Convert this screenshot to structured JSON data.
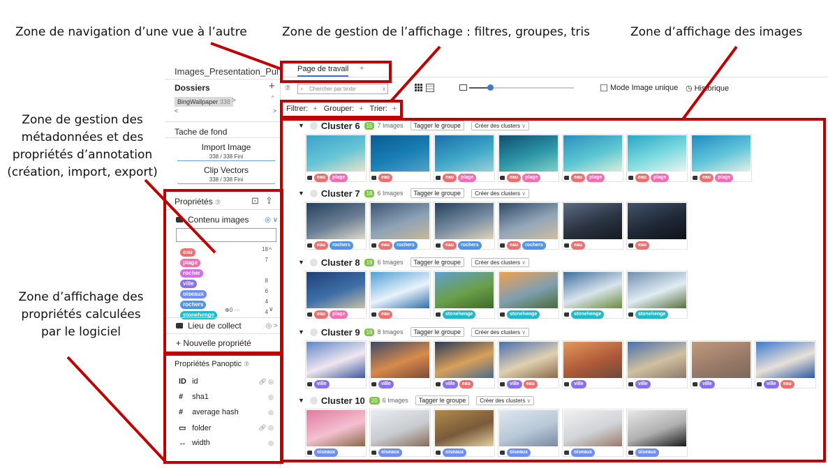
{
  "annotations": {
    "nav": "Zone de navigation d’une vue à l’autre",
    "display_mgmt": "Zone de gestion de l’affichage : filtres, groupes, tris",
    "images_zone": "Zone d’affichage des images",
    "meta_lines": [
      "Zone de gestion des",
      "métadonnées et des",
      "propriétés d’annotation",
      "(création, import, export)"
    ],
    "computed_lines": [
      "Zone d’affichage des",
      "propriétés calculées",
      "par le logiciel"
    ]
  },
  "app": {
    "project_title": "Images_Presentation_Publiq",
    "tab_label": "Page de travail",
    "tab_plus": "+",
    "search_placeholder": "Chercher par texte",
    "search_clear": "x",
    "help_glyph": "⑦",
    "mode_image_unique": "Mode Image unique",
    "historique": "Historique",
    "zoom_level": 0.2,
    "filters": {
      "filter": "Filtrer:",
      "group": "Grouper:",
      "sort": "Trier:",
      "plus": "+"
    }
  },
  "sidebar": {
    "dossiers_title": "Dossiers",
    "dossiers_plus": "+",
    "folder_name": "BingWallpaper",
    "folder_count": "338",
    "folder_chevron": ">",
    "tache_title": "Tache de fond",
    "tasks": [
      {
        "name": "Import Image",
        "status": "338 / 338 Fini"
      },
      {
        "name": "Clip Vectors",
        "status": "338 / 338 Fini"
      }
    ],
    "proprietes_title": "Propriétés",
    "contenu_label": "Contenu images",
    "tag_counts": [
      {
        "name": "eau",
        "count": "18",
        "color": "#ef6f6f"
      },
      {
        "name": "plage",
        "count": "7",
        "color": "#f06db0"
      },
      {
        "name": "rocher",
        "count": "",
        "color": "#d46be8"
      },
      {
        "name": "ville",
        "count": "8",
        "color": "#8a6ff0"
      },
      {
        "name": "oiseaux",
        "count": "6",
        "color": "#6d8ef2"
      },
      {
        "name": "rochers",
        "count": "4",
        "color": "#4f94e8"
      },
      {
        "name": "stonehenge",
        "count": "4",
        "color": "#21b8c9"
      }
    ],
    "stone_extra": "⊕0 ···",
    "lieu_label": "Lieu de collect",
    "nouvelle_label": "+ Nouvelle propriété",
    "panoptic_title": "Propriétés Panoptic",
    "panoptic_props": [
      {
        "icon": "ID",
        "name": "id"
      },
      {
        "icon": "#",
        "name": "sha1"
      },
      {
        "icon": "#",
        "name": "average hash"
      },
      {
        "icon": "▭",
        "name": "folder"
      },
      {
        "icon": "↔",
        "name": "width"
      }
    ]
  },
  "clusters": [
    {
      "title": "Cluster 6",
      "badge": "15",
      "count": "7 Images",
      "tag_btn": "Tagger le groupe",
      "create_btn": "Créer des clusters",
      "images": [
        [
          "eau",
          "plage"
        ],
        [
          "eau"
        ],
        [
          "eau",
          "plage"
        ],
        [
          "eau",
          "plage"
        ],
        [
          "eau",
          "plage"
        ],
        [
          "eau",
          "plage"
        ],
        [
          "eau",
          "plage"
        ]
      ],
      "palettes": [
        [
          "#3aa3c9",
          "#68c5d6",
          "#e8e4c8"
        ],
        [
          "#0a5c8f",
          "#1a7fb5",
          "#53a3c7"
        ],
        [
          "#1b6fa8",
          "#3fa7c8",
          "#9cd2d8"
        ],
        [
          "#0f4e6e",
          "#2d96a8",
          "#7fd1c7"
        ],
        [
          "#2a8fbf",
          "#5cc7d2",
          "#d9edd9"
        ],
        [
          "#27a7c4",
          "#7fdbe0",
          "#eef4f0"
        ],
        [
          "#1f8cc2",
          "#63c6da",
          "#e4efe6"
        ]
      ]
    },
    {
      "title": "Cluster 7",
      "badge": "18",
      "count": "6 Images",
      "tag_btn": "Tagger le groupe",
      "create_btn": "Créer des clusters",
      "images": [
        [
          "eau",
          "rochers"
        ],
        [
          "eau",
          "rochers"
        ],
        [
          "eau",
          "rochers"
        ],
        [
          "eau",
          "rochers"
        ],
        [
          "eau"
        ],
        [
          "eau"
        ]
      ],
      "palettes": [
        [
          "#23425e",
          "#6b7f94",
          "#e0d8c8"
        ],
        [
          "#3b5673",
          "#8ea2b6",
          "#c8b79a"
        ],
        [
          "#24405e",
          "#7a8ea3",
          "#e1d3b7"
        ],
        [
          "#2e4a66",
          "#93a6b9",
          "#cfbea0"
        ],
        [
          "#5b6d82",
          "#2a3341",
          "#151a21"
        ],
        [
          "#42536a",
          "#1f2835",
          "#0f131a"
        ]
      ]
    },
    {
      "title": "Cluster 8",
      "badge": "19",
      "count": "6 Images",
      "tag_btn": "Tagger le groupe",
      "create_btn": "Créer des clusters",
      "images": [
        [
          "eau",
          "plage"
        ],
        [
          "eau"
        ],
        [
          "stonehenge"
        ],
        [
          "stonehenge"
        ],
        [
          "stonehenge"
        ],
        [
          "stonehenge"
        ]
      ],
      "palettes": [
        [
          "#1f3f77",
          "#3f6fa8",
          "#c8c0a8"
        ],
        [
          "#4f9fd6",
          "#e8f2fa",
          "#2f6fa8"
        ],
        [
          "#5f9fd0",
          "#6b9f4a",
          "#3d6b2a"
        ],
        [
          "#f0a050",
          "#7f9fb0",
          "#4a6b3a"
        ],
        [
          "#3f6f9f",
          "#d8e4ec",
          "#6b8b3a"
        ],
        [
          "#6f8fb0",
          "#e0ecf2",
          "#5a6f3a"
        ]
      ]
    },
    {
      "title": "Cluster 9",
      "badge": "19",
      "count": "8 Images",
      "tag_btn": "Tagger le groupe",
      "create_btn": "Créer des clusters",
      "images": [
        [
          "ville"
        ],
        [
          "ville"
        ],
        [
          "ville",
          "eau"
        ],
        [
          "ville",
          "eau"
        ],
        [
          "ville"
        ],
        [
          "ville"
        ],
        [
          "ville"
        ],
        [
          "ville",
          "eau"
        ]
      ],
      "palettes": [
        [
          "#5f86c8",
          "#f0e6f0",
          "#3a5a9a"
        ],
        [
          "#3a4a6a",
          "#d88a4a",
          "#7a4a3a"
        ],
        [
          "#2a3a5a",
          "#d8a05a",
          "#4a6a8a"
        ],
        [
          "#4a6fb0",
          "#e0d0b0",
          "#8a6a4a"
        ],
        [
          "#e09a5a",
          "#b05a3a",
          "#6a4a3a"
        ],
        [
          "#4a6fb0",
          "#d0c0a0",
          "#8a7a6a"
        ],
        [
          "#c09a7a",
          "#9a7a6a",
          "#7a6a5a"
        ],
        [
          "#3a7ad0",
          "#e8e0d8",
          "#2a5aa0"
        ]
      ]
    },
    {
      "title": "Cluster 10",
      "badge": "20",
      "count": "6 Images",
      "tag_btn": "Tagger le groupe",
      "create_btn": "Créer des clusters",
      "images": [
        [
          "oiseaux"
        ],
        [
          "oiseaux"
        ],
        [
          "oiseaux"
        ],
        [
          "oiseaux"
        ],
        [
          "oiseaux"
        ],
        [
          "oiseaux"
        ]
      ],
      "palettes": [
        [
          "#e07aa0",
          "#f4c0d0",
          "#8a6a4a"
        ],
        [
          "#e8ecf0",
          "#c8ccd0",
          "#8a6a5a"
        ],
        [
          "#b08a4a",
          "#7a5a3a",
          "#e0d0a0"
        ],
        [
          "#dfe6ee",
          "#b8c8d8",
          "#7a8aa0"
        ],
        [
          "#f0f0f0",
          "#d0d4d8",
          "#9a7a6a"
        ],
        [
          "#e8e8e8",
          "#b0b0b0",
          "#1a1a1a"
        ]
      ]
    }
  ],
  "tag_colors": {
    "eau": "#ef6f6f",
    "plage": "#f06db0",
    "rochers": "#4f94e8",
    "stonehenge": "#21b8c9",
    "ville": "#8a6ff0",
    "oiseaux": "#6d8ef2"
  }
}
